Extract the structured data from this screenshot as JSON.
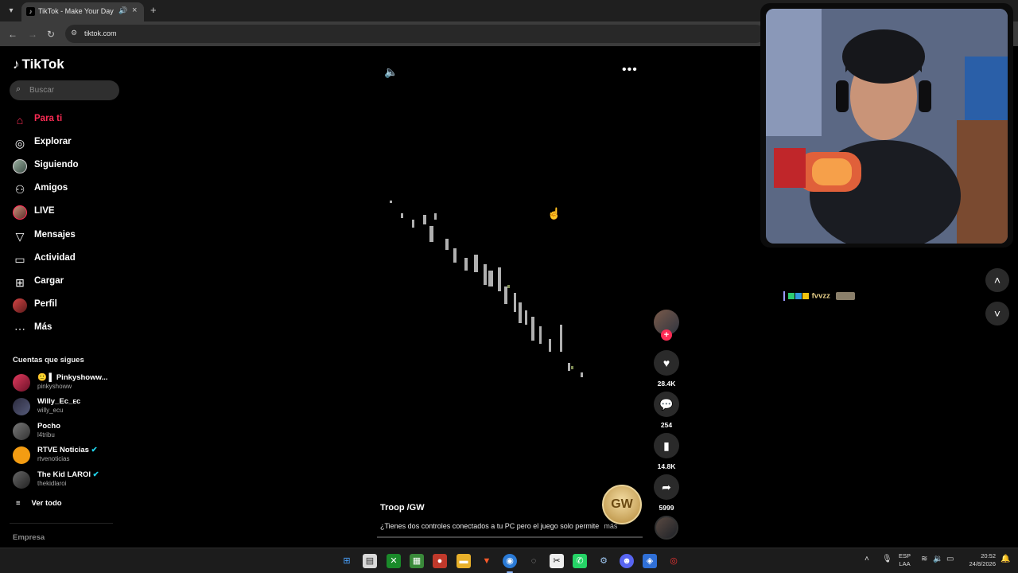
{
  "browser": {
    "tab_title": "TikTok - Make Your Day",
    "url": "tiktok.com"
  },
  "sidebar": {
    "logo": "TikTok",
    "search_placeholder": "Buscar",
    "nav": [
      {
        "label": "Para ti",
        "icon": "home-icon",
        "active": true
      },
      {
        "label": "Explorar",
        "icon": "compass-icon"
      },
      {
        "label": "Siguiendo",
        "icon": "avatar"
      },
      {
        "label": "Amigos",
        "icon": "friends-icon"
      },
      {
        "label": "LIVE",
        "icon": "avatar"
      },
      {
        "label": "Mensajes",
        "icon": "send-icon"
      },
      {
        "label": "Actividad",
        "icon": "message-icon"
      },
      {
        "label": "Cargar",
        "icon": "plus-square-icon"
      },
      {
        "label": "Perfil",
        "icon": "avatar"
      },
      {
        "label": "Más",
        "icon": "more-icon"
      }
    ],
    "following_title": "Cuentas que sigues",
    "following": [
      {
        "name": "Pinkyshoww...",
        "handle": "pinkyshoww"
      },
      {
        "name": "Willy_Ec_ᴇᴄ",
        "handle": "willy_ecu"
      },
      {
        "name": "Pocho",
        "handle": "l4tribu"
      },
      {
        "name": "RTVE Noticias",
        "handle": "rtvenoticias",
        "verified": true
      },
      {
        "name": "The Kid LAROI",
        "handle": "thekidlaroi",
        "verified": true
      }
    ],
    "see_all": "Ver todo",
    "footer": "Empresa"
  },
  "video": {
    "author": "Troop /GW",
    "description": "¿Tienes dos controles conectados a tu PC pero el juego solo permite",
    "more": "más",
    "watermark": "GW",
    "likes": "28.4K",
    "comments": "254",
    "saves": "14.8K",
    "shares": "5999"
  },
  "chat": {
    "badges": "K",
    "username": "fvvzz"
  },
  "taskbar": {
    "lang_line1": "ESP",
    "lang_line2": "LAA",
    "time": "20:52",
    "date": "24/8/2026"
  },
  "colors": {
    "accent": "#fe2c55",
    "background": "#000000"
  }
}
